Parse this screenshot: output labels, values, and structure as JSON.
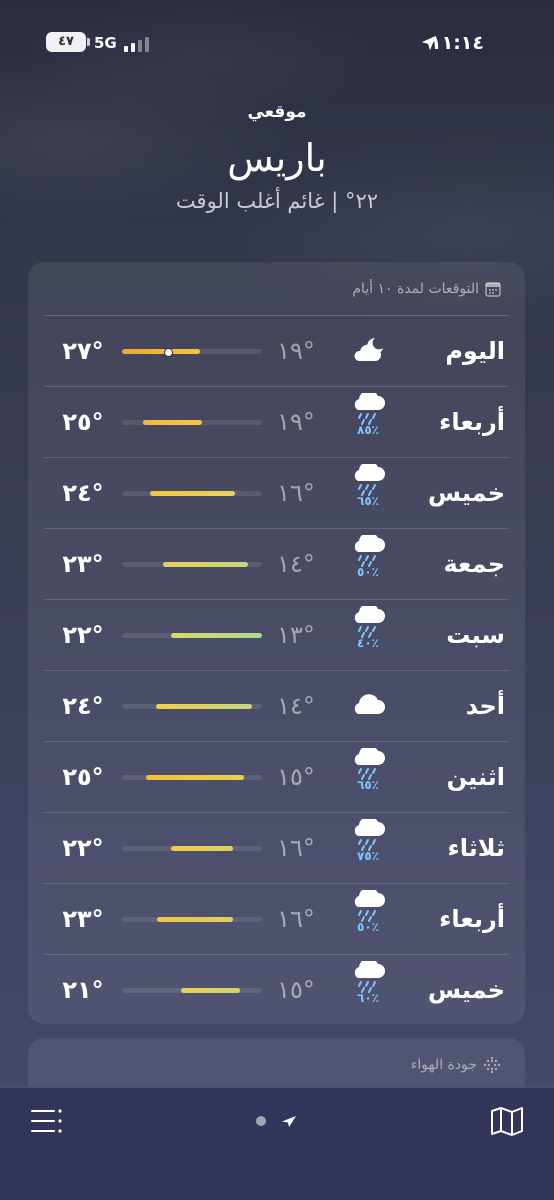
{
  "status_bar": {
    "battery": "٤٧",
    "network": "5G",
    "time": "١١:١٤"
  },
  "header": {
    "label": "موقعي",
    "city": "باريس",
    "condition": "٢٢° | غائم أغلب الوقت"
  },
  "forecast": {
    "title": "التوقعات لمدة ١٠ أيام",
    "rows": [
      {
        "day": "اليوم",
        "icon": "partly-cloudy-night-icon",
        "precip": "",
        "low": "١٩°",
        "high": "٢٧°",
        "bar_start": 0.0,
        "bar_end": 0.56,
        "bar_colors": [
          "#f2a33a",
          "#f6c640"
        ],
        "current": 0.33
      },
      {
        "day": "أربعاء",
        "icon": "rain-cloud-icon",
        "precip": "٨٥٪",
        "low": "١٩°",
        "high": "٢٥°",
        "bar_start": 0.15,
        "bar_end": 0.57,
        "bar_colors": [
          "#f5b83c",
          "#f6c640"
        ],
        "current": null
      },
      {
        "day": "خميس",
        "icon": "rain-cloud-icon",
        "precip": "٦٥٪",
        "low": "١٦°",
        "high": "٢٤°",
        "bar_start": 0.2,
        "bar_end": 0.81,
        "bar_colors": [
          "#f6c640",
          "#e8d35b"
        ],
        "current": null
      },
      {
        "day": "جمعة",
        "icon": "rain-cloud-icon",
        "precip": "٥٠٪",
        "low": "١٤°",
        "high": "٢٣°",
        "bar_start": 0.29,
        "bar_end": 0.9,
        "bar_colors": [
          "#e6d15a",
          "#c9d57a"
        ],
        "current": null
      },
      {
        "day": "سبت",
        "icon": "rain-cloud-icon",
        "precip": "٤٠٪",
        "low": "١٣°",
        "high": "٢٢°",
        "bar_start": 0.35,
        "bar_end": 1.0,
        "bar_colors": [
          "#dcd86a",
          "#a8d89a"
        ],
        "current": null
      },
      {
        "day": "أحد",
        "icon": "cloud-icon",
        "precip": "",
        "low": "١٤°",
        "high": "٢٤°",
        "bar_start": 0.24,
        "bar_end": 0.93,
        "bar_colors": [
          "#f0d04a",
          "#c6d582"
        ],
        "current": null
      },
      {
        "day": "اثنين",
        "icon": "rain-cloud-icon",
        "precip": "٦٥٪",
        "low": "١٥°",
        "high": "٢٥°",
        "bar_start": 0.17,
        "bar_end": 0.87,
        "bar_colors": [
          "#f5bd3e",
          "#e2d25a"
        ],
        "current": null
      },
      {
        "day": "ثلاثاء",
        "icon": "rain-cloud-icon",
        "precip": "٧٥٪",
        "low": "١٦°",
        "high": "٢٢°",
        "bar_start": 0.35,
        "bar_end": 0.79,
        "bar_colors": [
          "#f0ca46",
          "#dcd365"
        ],
        "current": null
      },
      {
        "day": "أربعاء",
        "icon": "rain-cloud-icon",
        "precip": "٥٠٪",
        "low": "١٦°",
        "high": "٢٣°",
        "bar_start": 0.25,
        "bar_end": 0.79,
        "bar_colors": [
          "#f2c440",
          "#dfd260"
        ],
        "current": null
      },
      {
        "day": "خميس",
        "icon": "rain-cloud-icon",
        "precip": "٦٠٪",
        "low": "١٥°",
        "high": "٢١°",
        "bar_start": 0.42,
        "bar_end": 0.84,
        "bar_colors": [
          "#e8cf56",
          "#d4d46a"
        ],
        "current": null
      }
    ]
  },
  "air_quality": {
    "title": "جودة الهواء"
  },
  "colors": {
    "accent_precip": "#7fc4ff",
    "background": "#3a3d56"
  }
}
